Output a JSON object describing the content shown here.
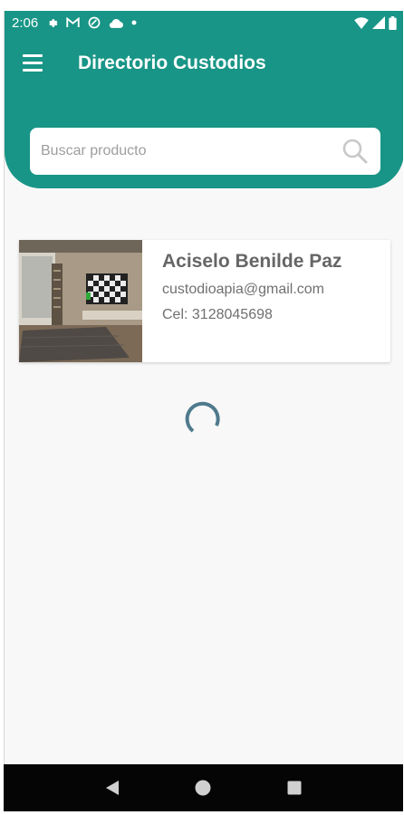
{
  "status_bar": {
    "time": "2:06",
    "icons": [
      "settings-icon",
      "gmail-icon",
      "vpn-icon",
      "cloud-icon",
      "dot-icon",
      "wifi-icon",
      "signal-icon",
      "battery-icon"
    ]
  },
  "header": {
    "title": "Directorio Custodios",
    "menu_icon": "hamburger-menu-icon"
  },
  "search": {
    "placeholder": "Buscar producto",
    "value": ""
  },
  "custodians": [
    {
      "name": "Aciselo Benilde Paz",
      "email": "custodioapia@gmail.com",
      "phone": "Cel: 3128045698"
    }
  ],
  "loading": true,
  "nav_bar": {
    "buttons": [
      "back-icon",
      "home-icon",
      "recents-icon"
    ]
  },
  "colors": {
    "primary": "#189586",
    "background": "#f8f8f8",
    "text_secondary": "#707070",
    "spinner": "#4f7a8c"
  }
}
